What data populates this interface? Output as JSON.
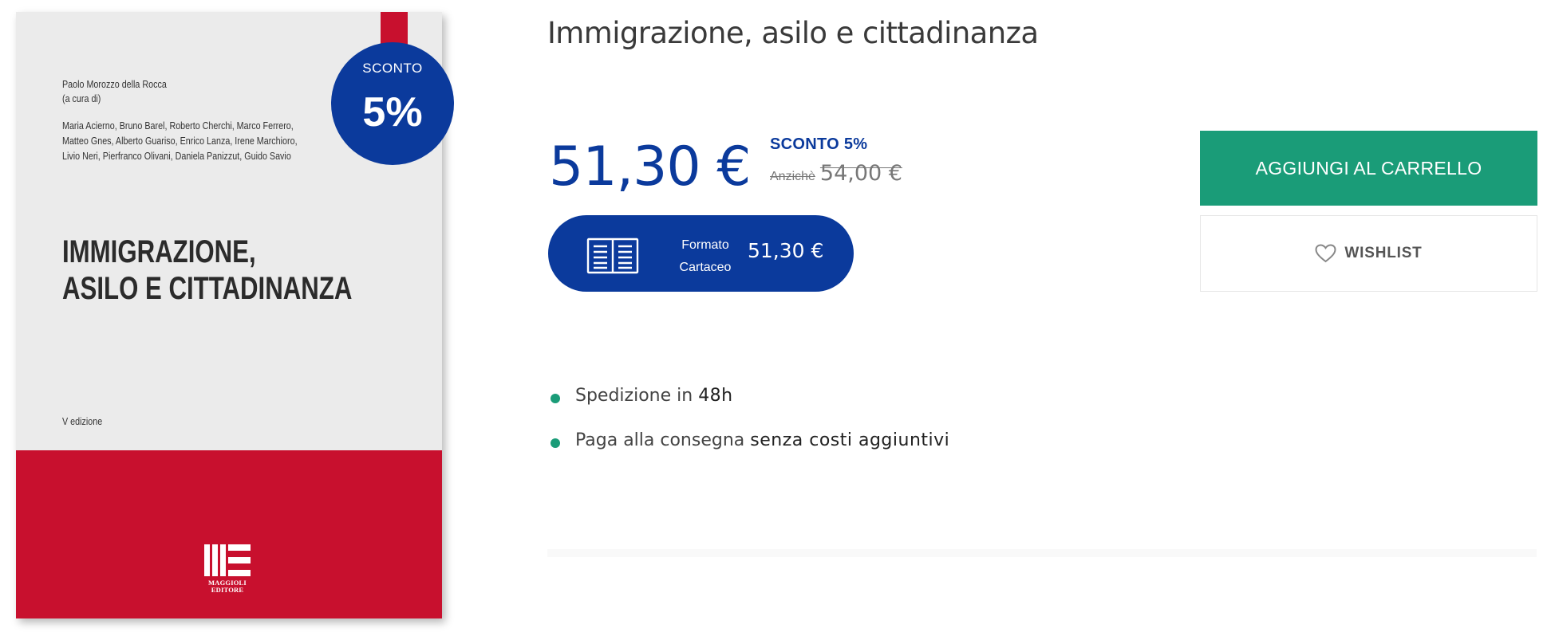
{
  "cover": {
    "editor_name": "Paolo Morozzo della Rocca",
    "editor_role": "(a cura di)",
    "authors": [
      "Maria Acierno, Bruno Barel, Roberto Cherchi, Marco Ferrero,",
      "Matteo Gnes, Alberto Guariso, Enrico Lanza, Irene Marchioro,",
      "Livio Neri, Pierfranco Olivani, Daniela Panizzut, Guido Savio"
    ],
    "title_lines": [
      "IMMIGRAZIONE,",
      "ASILO E CITTADINANZA"
    ],
    "edition": "V edizione",
    "publisher_lines": [
      "MAGGIOLI",
      "EDITORE"
    ],
    "colors": {
      "band": "#c8102e",
      "background": "#ebebeb"
    }
  },
  "badge": {
    "label": "SCONTO",
    "value": "5%",
    "color": "#0b3a9c"
  },
  "product": {
    "title": "Immigrazione, asilo e cittadinanza",
    "price": "51,30 €",
    "discount_label": "SCONTO 5%",
    "old_price_prefix": "Anzichè",
    "old_price": "54,00 €",
    "format": {
      "line1": "Formato",
      "line2": "Cartaceo",
      "price": "51,30 €",
      "icon": "book-icon"
    },
    "features": [
      {
        "text": "Spedizione in ",
        "strong": "48h"
      },
      {
        "text": "Paga alla consegna ",
        "strong": "senza costi aggiuntivi"
      }
    ]
  },
  "actions": {
    "cart_label": "AGGIUNGI AL CARRELLO",
    "wishlist_label": "WISHLIST",
    "wishlist_icon": "heart-icon"
  },
  "colors": {
    "primary_blue": "#0b3a9c",
    "accent_green": "#1a9c78"
  }
}
